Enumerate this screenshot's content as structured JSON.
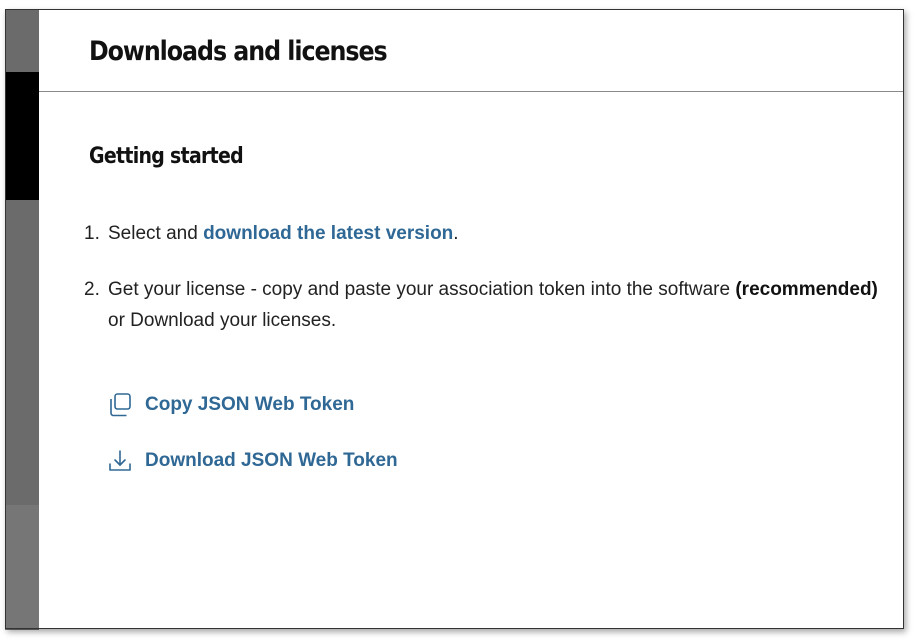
{
  "header": {
    "title": "Downloads and licenses"
  },
  "section": {
    "title": "Getting started"
  },
  "steps": [
    {
      "number": "1.",
      "prefix": "Select and ",
      "link": "download the latest version",
      "suffix": "."
    },
    {
      "number": "2.",
      "text": "Get your license - copy and paste your association token into the software ",
      "bold": "(recommended)",
      "suffix": " or Download your licenses."
    }
  ],
  "actions": {
    "copy": {
      "label": "Copy JSON Web Token",
      "icon": "copy-icon"
    },
    "download": {
      "label": "Download JSON Web Token",
      "icon": "download-icon"
    }
  },
  "colors": {
    "link": "#2f6895",
    "text": "#222222",
    "sidebar": "#6b6b6b"
  }
}
